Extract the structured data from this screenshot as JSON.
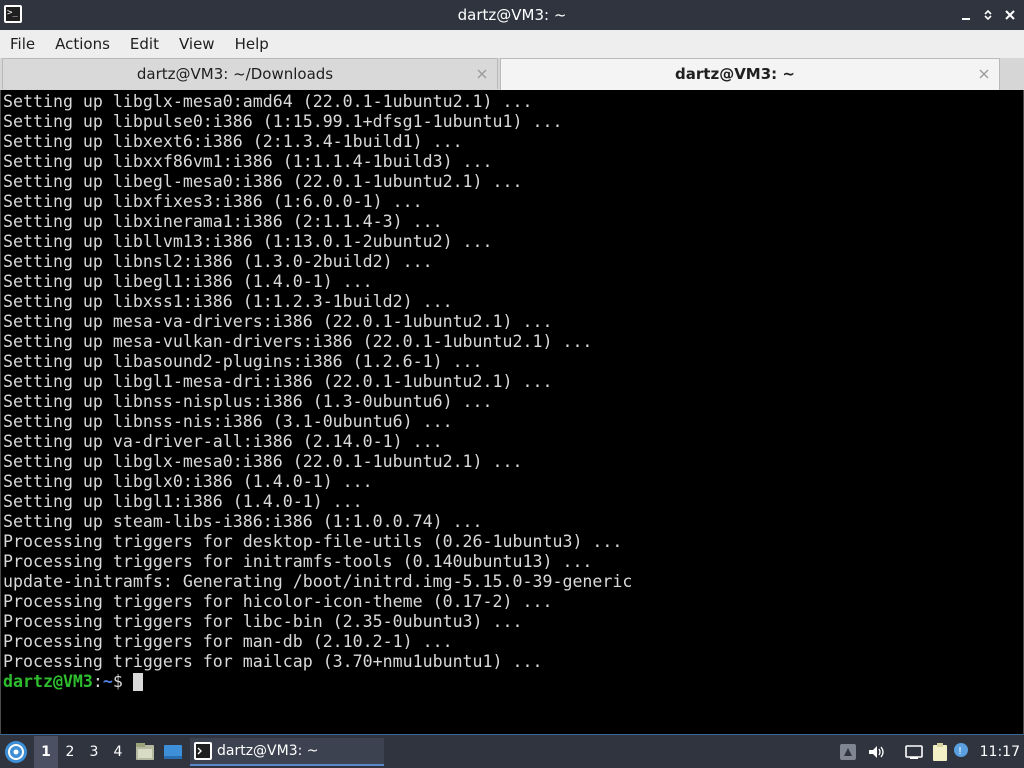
{
  "window": {
    "title": "dartz@VM3: ~",
    "app_icon": "terminal-icon",
    "controls": [
      "minimize-icon",
      "maximize-icon",
      "close-icon"
    ]
  },
  "menubar": {
    "items": [
      "File",
      "Actions",
      "Edit",
      "View",
      "Help"
    ]
  },
  "tabs": [
    {
      "label": "dartz@VM3: ~/Downloads",
      "active": false
    },
    {
      "label": "dartz@VM3: ~",
      "active": true
    }
  ],
  "terminal": {
    "lines": [
      "Setting up libglx-mesa0:amd64 (22.0.1-1ubuntu2.1) ...",
      "Setting up libpulse0:i386 (1:15.99.1+dfsg1-1ubuntu1) ...",
      "Setting up libxext6:i386 (2:1.3.4-1build1) ...",
      "Setting up libxxf86vm1:i386 (1:1.1.4-1build3) ...",
      "Setting up libegl-mesa0:i386 (22.0.1-1ubuntu2.1) ...",
      "Setting up libxfixes3:i386 (1:6.0.0-1) ...",
      "Setting up libxinerama1:i386 (2:1.1.4-3) ...",
      "Setting up libllvm13:i386 (1:13.0.1-2ubuntu2) ...",
      "Setting up libnsl2:i386 (1.3.0-2build2) ...",
      "Setting up libegl1:i386 (1.4.0-1) ...",
      "Setting up libxss1:i386 (1:1.2.3-1build2) ...",
      "Setting up mesa-va-drivers:i386 (22.0.1-1ubuntu2.1) ...",
      "Setting up mesa-vulkan-drivers:i386 (22.0.1-1ubuntu2.1) ...",
      "Setting up libasound2-plugins:i386 (1.2.6-1) ...",
      "Setting up libgl1-mesa-dri:i386 (22.0.1-1ubuntu2.1) ...",
      "Setting up libnss-nisplus:i386 (1.3-0ubuntu6) ...",
      "Setting up libnss-nis:i386 (3.1-0ubuntu6) ...",
      "Setting up va-driver-all:i386 (2.14.0-1) ...",
      "Setting up libglx-mesa0:i386 (22.0.1-1ubuntu2.1) ...",
      "Setting up libglx0:i386 (1.4.0-1) ...",
      "Setting up libgl1:i386 (1.4.0-1) ...",
      "Setting up steam-libs-i386:i386 (1:1.0.0.74) ...",
      "Processing triggers for desktop-file-utils (0.26-1ubuntu3) ...",
      "Processing triggers for initramfs-tools (0.140ubuntu13) ...",
      "update-initramfs: Generating /boot/initrd.img-5.15.0-39-generic",
      "Processing triggers for hicolor-icon-theme (0.17-2) ...",
      "Processing triggers for libc-bin (2.35-0ubuntu3) ...",
      "Processing triggers for man-db (2.10.2-1) ...",
      "Processing triggers for mailcap (3.70+nmu1ubuntu1) ..."
    ],
    "prompt": {
      "user_host": "dartz@VM3",
      "colon": ":",
      "path": "~",
      "symbol": "$"
    },
    "colors": {
      "background": "#000000",
      "text": "#d9d9d9",
      "prompt_user": "#2ebd2e",
      "prompt_path": "#4f7fdf"
    }
  },
  "taskbar": {
    "start_icon": "lubuntu-menu-icon",
    "workspaces": [
      "1",
      "2",
      "3",
      "4"
    ],
    "active_workspace": "1",
    "quicklaunch": [
      "file-manager-icon",
      "show-desktop-icon"
    ],
    "task": {
      "label": "dartz@VM3: ~",
      "icon": "terminal-icon"
    },
    "tray": [
      "tray-app-icon",
      "volume-icon",
      "network-icon",
      "clipboard-icon",
      "update-notifier-icon"
    ],
    "clock": "11:17"
  }
}
